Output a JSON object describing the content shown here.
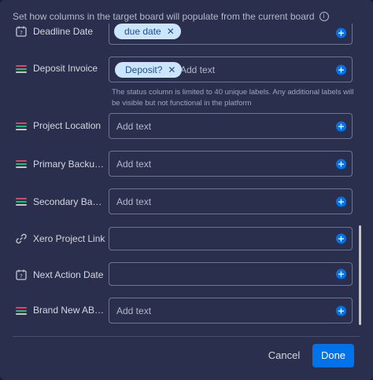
{
  "header": {
    "note": "Set how columns in the target board will populate from the current board"
  },
  "rows": [
    {
      "label": "Deadline Date",
      "icon": "calendar-icon",
      "chips": [
        "due date"
      ],
      "placeholder": ""
    },
    {
      "label": "Deposit Invoice",
      "icon": "status-icon",
      "chips": [
        "Deposit?"
      ],
      "placeholder": "Add text",
      "helper": "The status column is limited to 40 unique labels. Any additional labels will be visible but not functional in the platform"
    },
    {
      "label": "Project Location",
      "icon": "status-icon",
      "placeholder": "Add text"
    },
    {
      "label": "Primary Backup L...",
      "icon": "status-icon",
      "placeholder": "Add text"
    },
    {
      "label": "Secondary Backu...",
      "icon": "status-icon",
      "placeholder": "Add text"
    },
    {
      "label": "Xero Project Link",
      "icon": "link-icon",
      "placeholder": ""
    },
    {
      "label": "Next Action Date",
      "icon": "calendar-icon",
      "placeholder": ""
    },
    {
      "label": "Brand New ABC ...",
      "icon": "status-icon",
      "placeholder": "Add text"
    }
  ],
  "footer": {
    "cancel_label": "Cancel",
    "done_label": "Done"
  },
  "colors": {
    "panel_bg": "#292f4c",
    "field_border": "#6e7593",
    "accent": "#0073ea",
    "chip_bg": "#cce5ff",
    "status_red": "#e2445c",
    "status_green": "#00c875",
    "status_gray": "#c4c4c4"
  }
}
